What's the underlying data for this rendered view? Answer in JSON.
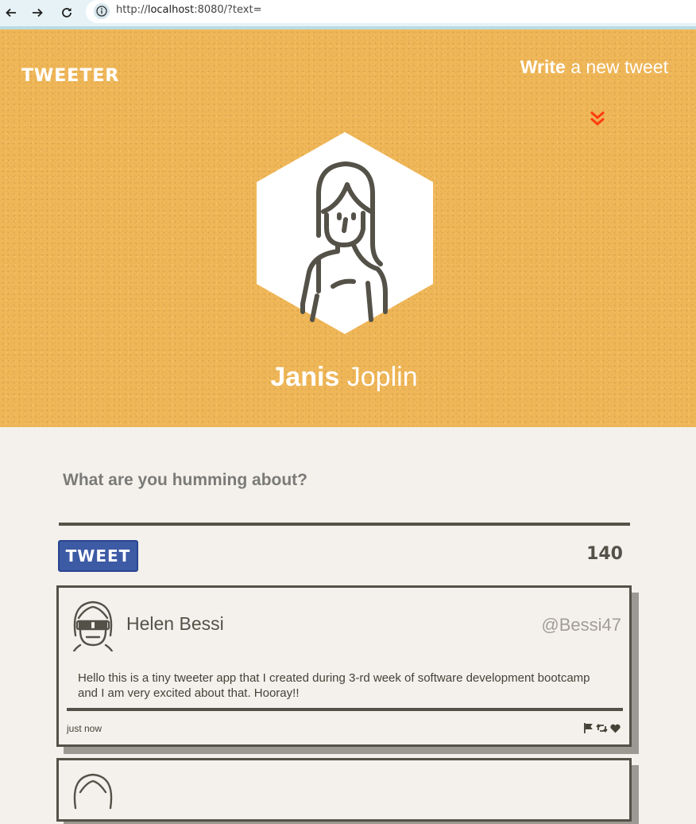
{
  "browser": {
    "url_scheme": "http://",
    "url_host": "localhost",
    "url_rest": ":8080/?text=",
    "icons": [
      "back-arrow-icon",
      "forward-arrow-icon",
      "reload-icon",
      "info-icon"
    ]
  },
  "header": {
    "logo": "TWEETER",
    "compose_bold": "Write",
    "compose_rest": " a new tweet",
    "chevron_color": "#ff3b0f",
    "background_color": "#f0b758"
  },
  "profile": {
    "first_name": "Janis",
    "last_name": " Joplin"
  },
  "compose": {
    "prompt": "What are you humming about?",
    "button_label": "TWEET",
    "counter": "140",
    "button_color": "#3d5aa5"
  },
  "tweets": [
    {
      "name": "Helen Bessi",
      "handle": "@Bessi47",
      "text": "Hello this is a tiny tweeter app that I created during 3-rd week of software development bootcamp and I am very excited about that. Hooray!!",
      "time": "just now",
      "actions": [
        "flag-icon",
        "retweet-icon",
        "heart-icon"
      ]
    }
  ]
}
